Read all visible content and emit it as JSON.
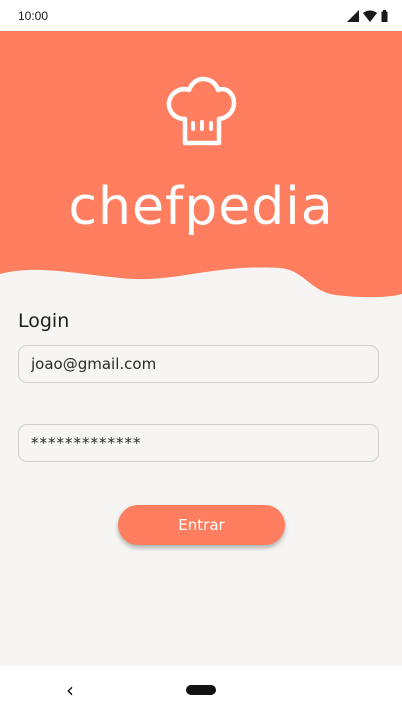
{
  "status_bar": {
    "time": "10:00",
    "icons": [
      "signal-icon",
      "wifi-icon",
      "battery-icon"
    ]
  },
  "header": {
    "brand": "chefpedia",
    "logo_icon": "chef-hat-icon",
    "color": "#ff7e5f"
  },
  "login": {
    "title": "Login",
    "email_value": "joao@gmail.com",
    "password_value": "*************",
    "submit_label": "Entrar"
  },
  "nav_bar": {
    "back_glyph": "‹",
    "back_icon": "back-chevron-icon",
    "home_icon": "home-pill-icon"
  },
  "colors": {
    "accent": "#ff7e5f",
    "background": "#f6f5f3"
  }
}
